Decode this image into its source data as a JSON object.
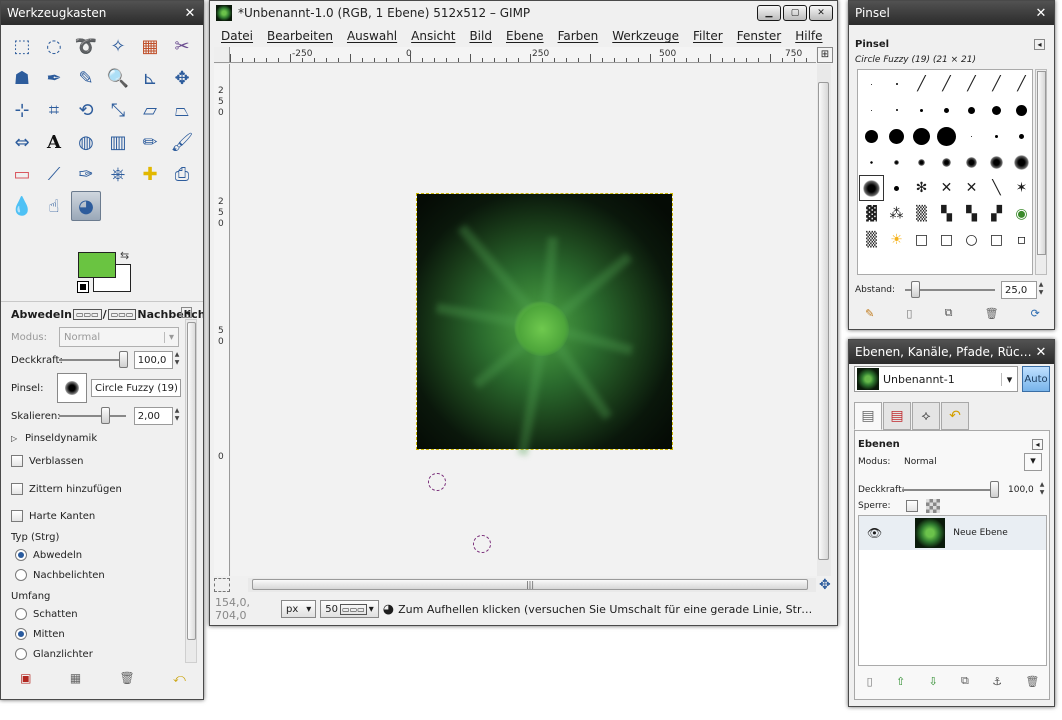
{
  "toolbox": {
    "title": "Werkzeugkasten",
    "tool_icons": [
      "rect-select-icon",
      "ellipse-select-icon",
      "lasso-icon",
      "magic-wand-icon",
      "color-select-icon",
      "scissors-icon",
      "foreground-select-icon",
      "paths-icon",
      "color-picker-icon",
      "zoom-icon",
      "measure-icon",
      "move-icon",
      "align-icon",
      "crop-icon",
      "rotate-icon",
      "scale-icon",
      "shear-icon",
      "perspective-icon",
      "flip-icon",
      "text-icon",
      "bucket-fill-icon",
      "blend-icon",
      "pencil-icon",
      "paintbrush-icon",
      "eraser-icon",
      "airbrush-icon",
      "ink-icon",
      "clone-icon",
      "heal-icon",
      "perspective-clone-icon",
      "blur-icon",
      "smudge-icon",
      "dodge-burn-icon"
    ],
    "foreground_color": "#6ac441",
    "background_color": "#ffffff",
    "options": {
      "title_left": "Abwedeln",
      "title_sep": "/",
      "title_right": "Nachbelichten",
      "modus_label": "Modus:",
      "modus_value": "Normal",
      "deckkraft_label": "Deckkraft:",
      "deckkraft_value": "100,0",
      "pinsel_label": "Pinsel:",
      "pinsel_value": "Circle Fuzzy (19)",
      "skalieren_label": "Skalieren:",
      "skalieren_value": "2,00",
      "pinseldynamik": "Pinseldynamik",
      "verblassen": "Verblassen",
      "zittern": "Zittern hinzufügen",
      "harte_kanten": "Harte Kanten",
      "typ_label": "Typ (Strg)",
      "typ_abwedeln": "Abwedeln",
      "typ_nachbelichten": "Nachbelichten",
      "umfang_label": "Umfang",
      "umfang_schatten": "Schatten",
      "umfang_mitten": "Mitten",
      "umfang_glanzlichter": "Glanzlichter"
    }
  },
  "image_window": {
    "title": "*Unbenannt-1.0 (RGB, 1 Ebene) 512x512 – GIMP",
    "menu": [
      "Datei",
      "Bearbeiten",
      "Auswahl",
      "Ansicht",
      "Bild",
      "Ebene",
      "Farben",
      "Werkzeuge",
      "Filter",
      "Fenster",
      "Hilfe"
    ],
    "ruler_h": [
      "-250",
      "0",
      "250",
      "500",
      "750"
    ],
    "ruler_v": [
      "2",
      "5",
      "0",
      "2",
      "5",
      "0",
      "5",
      "0",
      "0"
    ],
    "status": {
      "coords": "154,0, 704,0",
      "unit": "px",
      "zoom": "50",
      "message": "Zum Aufhellen klicken (versuchen Sie Umschalt für eine gerade Linie, Strg zu..."
    }
  },
  "brushes_dock": {
    "title": "Pinsel",
    "label": "Pinsel",
    "selected": "Circle Fuzzy (19) (21 × 21)",
    "spacing_label": "Abstand:",
    "spacing_value": "25,0"
  },
  "layers_dock": {
    "title": "Ebenen, Kanäle, Pfade, Rückgän...",
    "image_name": "Unbenannt-1",
    "auto_label": "Auto",
    "ebenen_label": "Ebenen",
    "modus_label": "Modus:",
    "modus_value": "Normal",
    "deckkraft_label": "Deckkraft:",
    "deckkraft_value": "100,0",
    "sperre_label": "Sperre:",
    "layer_name": "Neue Ebene"
  }
}
